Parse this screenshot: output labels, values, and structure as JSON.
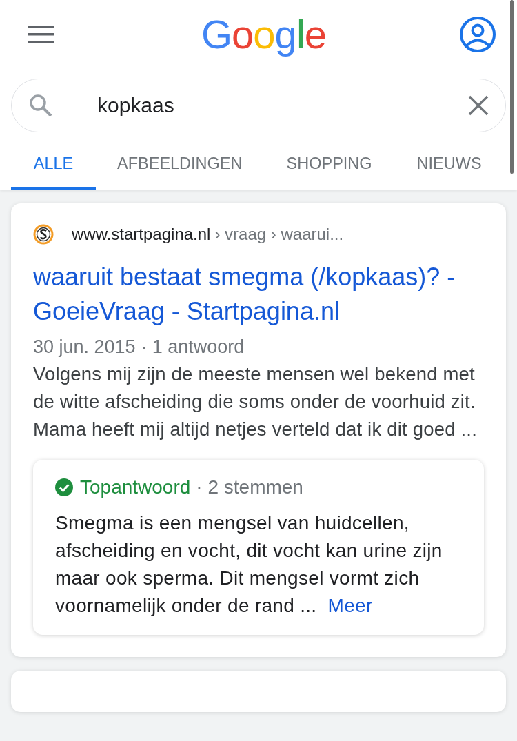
{
  "header": {
    "logo": "Google"
  },
  "search": {
    "value": "kopkaas"
  },
  "tabs": [
    {
      "label": "ALLE",
      "selected": true
    },
    {
      "label": "AFBEELDINGEN",
      "selected": false
    },
    {
      "label": "SHOPPING",
      "selected": false
    },
    {
      "label": "NIEUWS",
      "selected": false
    }
  ],
  "results": [
    {
      "site": "www.startpagina.nl",
      "path": "› vraag › waarui...",
      "title": "waaruit bestaat smegma (/kopkaas)? - GoeieVraag - Startpagina.nl",
      "meta": "30 jun. 2015 · 1 antwoord",
      "snippet": "Volgens mij zijn de meeste mensen wel bekend met de witte afscheiding die soms onder de voorhuid zit. Mama heeft mij altijd netjes verteld dat ik dit goed ...",
      "answer": {
        "badge": "Topantwoord",
        "votes": "· 2 stemmen",
        "text": "Smegma is een mengsel van huidcellen, afscheiding en vocht, dit vocht kan urine zijn maar ook sperma. Dit mengsel vormt zich voornamelijk onder de rand ...",
        "more": "Meer"
      }
    }
  ]
}
